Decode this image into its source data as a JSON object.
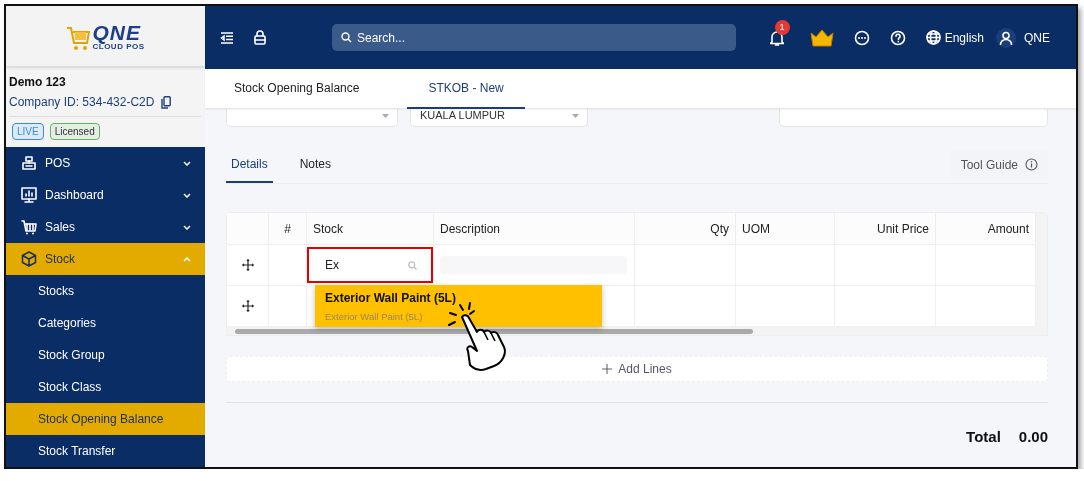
{
  "sidebar": {
    "logo": {
      "wordmark": "QNE",
      "tagline": "CLOUD POS"
    },
    "company": {
      "name": "Demo 123",
      "id_label": "Company ID: 534-432-C2D"
    },
    "badges": [
      {
        "label": "LIVE",
        "color": "#2f8fe8"
      },
      {
        "label": "Licensed",
        "color": "#5cb85c"
      }
    ],
    "nav": [
      {
        "label": "POS",
        "expanded": false,
        "selected": false
      },
      {
        "label": "Dashboard",
        "expanded": false,
        "selected": false
      },
      {
        "label": "Sales",
        "expanded": false,
        "selected": false
      },
      {
        "label": "Stock",
        "expanded": true,
        "selected": true,
        "children": [
          {
            "label": "Stocks",
            "selected": false
          },
          {
            "label": "Categories",
            "selected": false
          },
          {
            "label": "Stock Group",
            "selected": false
          },
          {
            "label": "Stock Class",
            "selected": false
          },
          {
            "label": "Stock Opening Balance",
            "selected": true
          },
          {
            "label": "Stock Transfer",
            "selected": false
          }
        ]
      }
    ]
  },
  "header": {
    "search": {
      "placeholder": "Search..."
    },
    "notification_count": "1",
    "language": "English",
    "user": "QNE"
  },
  "page_tabs": [
    {
      "label": "Stock Opening Balance",
      "selected": false
    },
    {
      "label": "STKOB - New",
      "selected": true
    }
  ],
  "form": {
    "location": "KUALA LUMPUR"
  },
  "detail_tabs": [
    {
      "label": "Details",
      "selected": true
    },
    {
      "label": "Notes",
      "selected": false
    }
  ],
  "tool_guide": "Tool Guide",
  "table": {
    "columns": [
      {
        "label": "#"
      },
      {
        "label": "Stock"
      },
      {
        "label": "Description"
      },
      {
        "label": "Qty"
      },
      {
        "label": "UOM"
      },
      {
        "label": "Unit Price"
      },
      {
        "label": "Amount"
      }
    ],
    "rows": [
      {
        "kind": "editing",
        "stock": "Ex"
      },
      {
        "kind": "empty"
      }
    ]
  },
  "suggestions": [
    {
      "title": "Exterior Wall Paint (5L)",
      "subtitle": "Exterior Wall Paint (5L)",
      "selected": true
    }
  ],
  "add_lines": "Add Lines",
  "total": {
    "label": "Total",
    "value": "0.00"
  }
}
